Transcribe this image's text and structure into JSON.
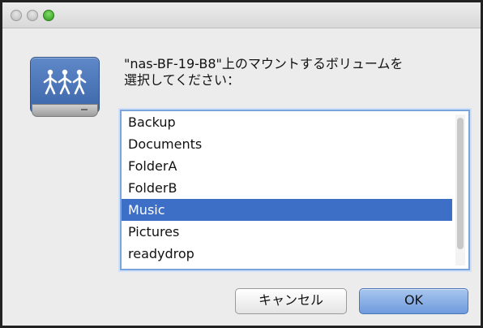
{
  "dialog": {
    "prompt_line1": "\"nas-BF-19-B8\"上のマウントするボリュームを",
    "prompt_line2": "選択してください："
  },
  "volumes": {
    "items": [
      "Backup",
      "Documents",
      "FolderA",
      "FolderB",
      "Music",
      "Pictures",
      "readydrop"
    ],
    "selected": "Music"
  },
  "buttons": {
    "cancel_label": "キャンセル",
    "ok_label": "OK"
  },
  "icons": {
    "window": [
      "close-light",
      "minimize-light",
      "zoom-light"
    ],
    "app": "network-drive-icon"
  },
  "colors": {
    "selection": "#3d6fc7",
    "list_focus_border": "#7ba3dd",
    "ok_button": "#6f9bdd",
    "zoom_light": "#2f9a1a"
  }
}
